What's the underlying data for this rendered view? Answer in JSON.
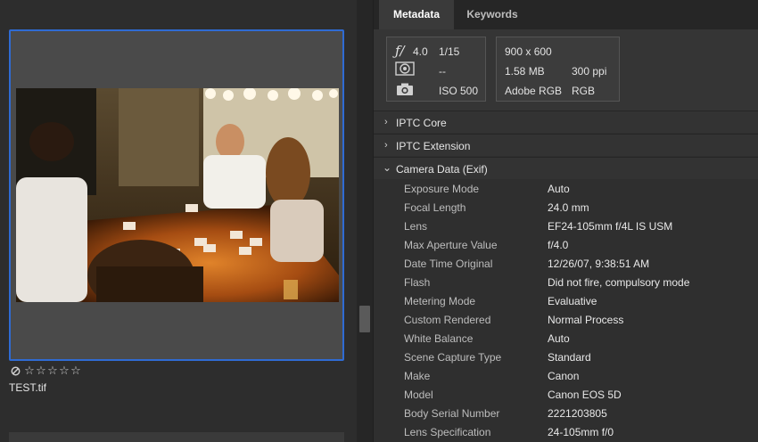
{
  "grid": {
    "filename": "TEST.tif",
    "rating_stars": 0,
    "max_stars": 5
  },
  "tabs": [
    {
      "label": "Metadata",
      "active": true
    },
    {
      "label": "Keywords",
      "active": false
    }
  ],
  "exposure": {
    "aperture": "4.0",
    "shutter": "1/15",
    "metering": "--",
    "iso": "ISO 500"
  },
  "file_info": {
    "dimensions": "900 x 600",
    "size": "1.58 MB",
    "resolution": "300 ppi",
    "color_profile": "Adobe RGB",
    "color_mode": "RGB"
  },
  "sections": [
    {
      "label": "IPTC Core",
      "expanded": false
    },
    {
      "label": "IPTC Extension",
      "expanded": false
    },
    {
      "label": "Camera Data (Exif)",
      "expanded": true
    }
  ],
  "exif": [
    {
      "key": "Exposure Mode",
      "value": "Auto"
    },
    {
      "key": "Focal Length",
      "value": "24.0 mm"
    },
    {
      "key": "Lens",
      "value": "EF24-105mm f/4L IS USM"
    },
    {
      "key": "Max Aperture Value",
      "value": "f/4.0"
    },
    {
      "key": "Date Time Original",
      "value": "12/26/07, 9:38:51 AM"
    },
    {
      "key": "Flash",
      "value": "Did not fire, compulsory mode"
    },
    {
      "key": "Metering Mode",
      "value": "Evaluative"
    },
    {
      "key": "Custom Rendered",
      "value": "Normal Process"
    },
    {
      "key": "White Balance",
      "value": "Auto"
    },
    {
      "key": "Scene Capture Type",
      "value": "Standard"
    },
    {
      "key": "Make",
      "value": "Canon"
    },
    {
      "key": "Model",
      "value": "Canon EOS 5D"
    },
    {
      "key": "Body Serial Number",
      "value": "2221203805"
    },
    {
      "key": "Lens Specification",
      "value": "24-105mm f/0"
    }
  ],
  "colors": {
    "selection": "#2f6bd3",
    "panel": "#2f2f2f"
  }
}
